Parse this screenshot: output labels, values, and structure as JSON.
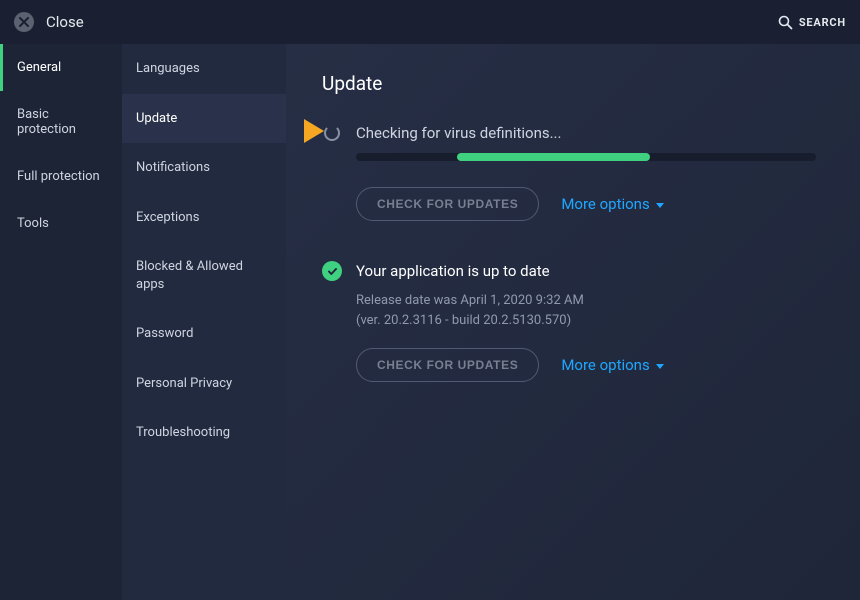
{
  "topbar": {
    "close_label": "Close",
    "search_label": "SEARCH"
  },
  "nav1": {
    "items": [
      {
        "label": "General"
      },
      {
        "label": "Basic protection"
      },
      {
        "label": "Full protection"
      },
      {
        "label": "Tools"
      }
    ],
    "active_index": 0
  },
  "nav2": {
    "items": [
      {
        "label": "Languages"
      },
      {
        "label": "Update"
      },
      {
        "label": "Notifications"
      },
      {
        "label": "Exceptions"
      },
      {
        "label": "Blocked & Allowed apps"
      },
      {
        "label": "Password"
      },
      {
        "label": "Personal Privacy"
      },
      {
        "label": "Troubleshooting"
      }
    ],
    "active_index": 1
  },
  "page": {
    "title": "Update"
  },
  "virus_defs": {
    "status_text": "Checking for virus definitions...",
    "progress_percent": 42,
    "check_button": "CHECK FOR UPDATES",
    "more_options": "More options"
  },
  "app_update": {
    "status_text": "Your application is up to date",
    "release_line": "Release date was April 1, 2020 9:32 AM",
    "version_line": "(ver. 20.2.3116 - build 20.2.5130.570)",
    "check_button": "CHECK FOR UPDATES",
    "more_options": "More options"
  },
  "colors": {
    "accent_green": "#3fd17f",
    "link_blue": "#1fa7ff",
    "pointer_orange": "#f5a623"
  }
}
